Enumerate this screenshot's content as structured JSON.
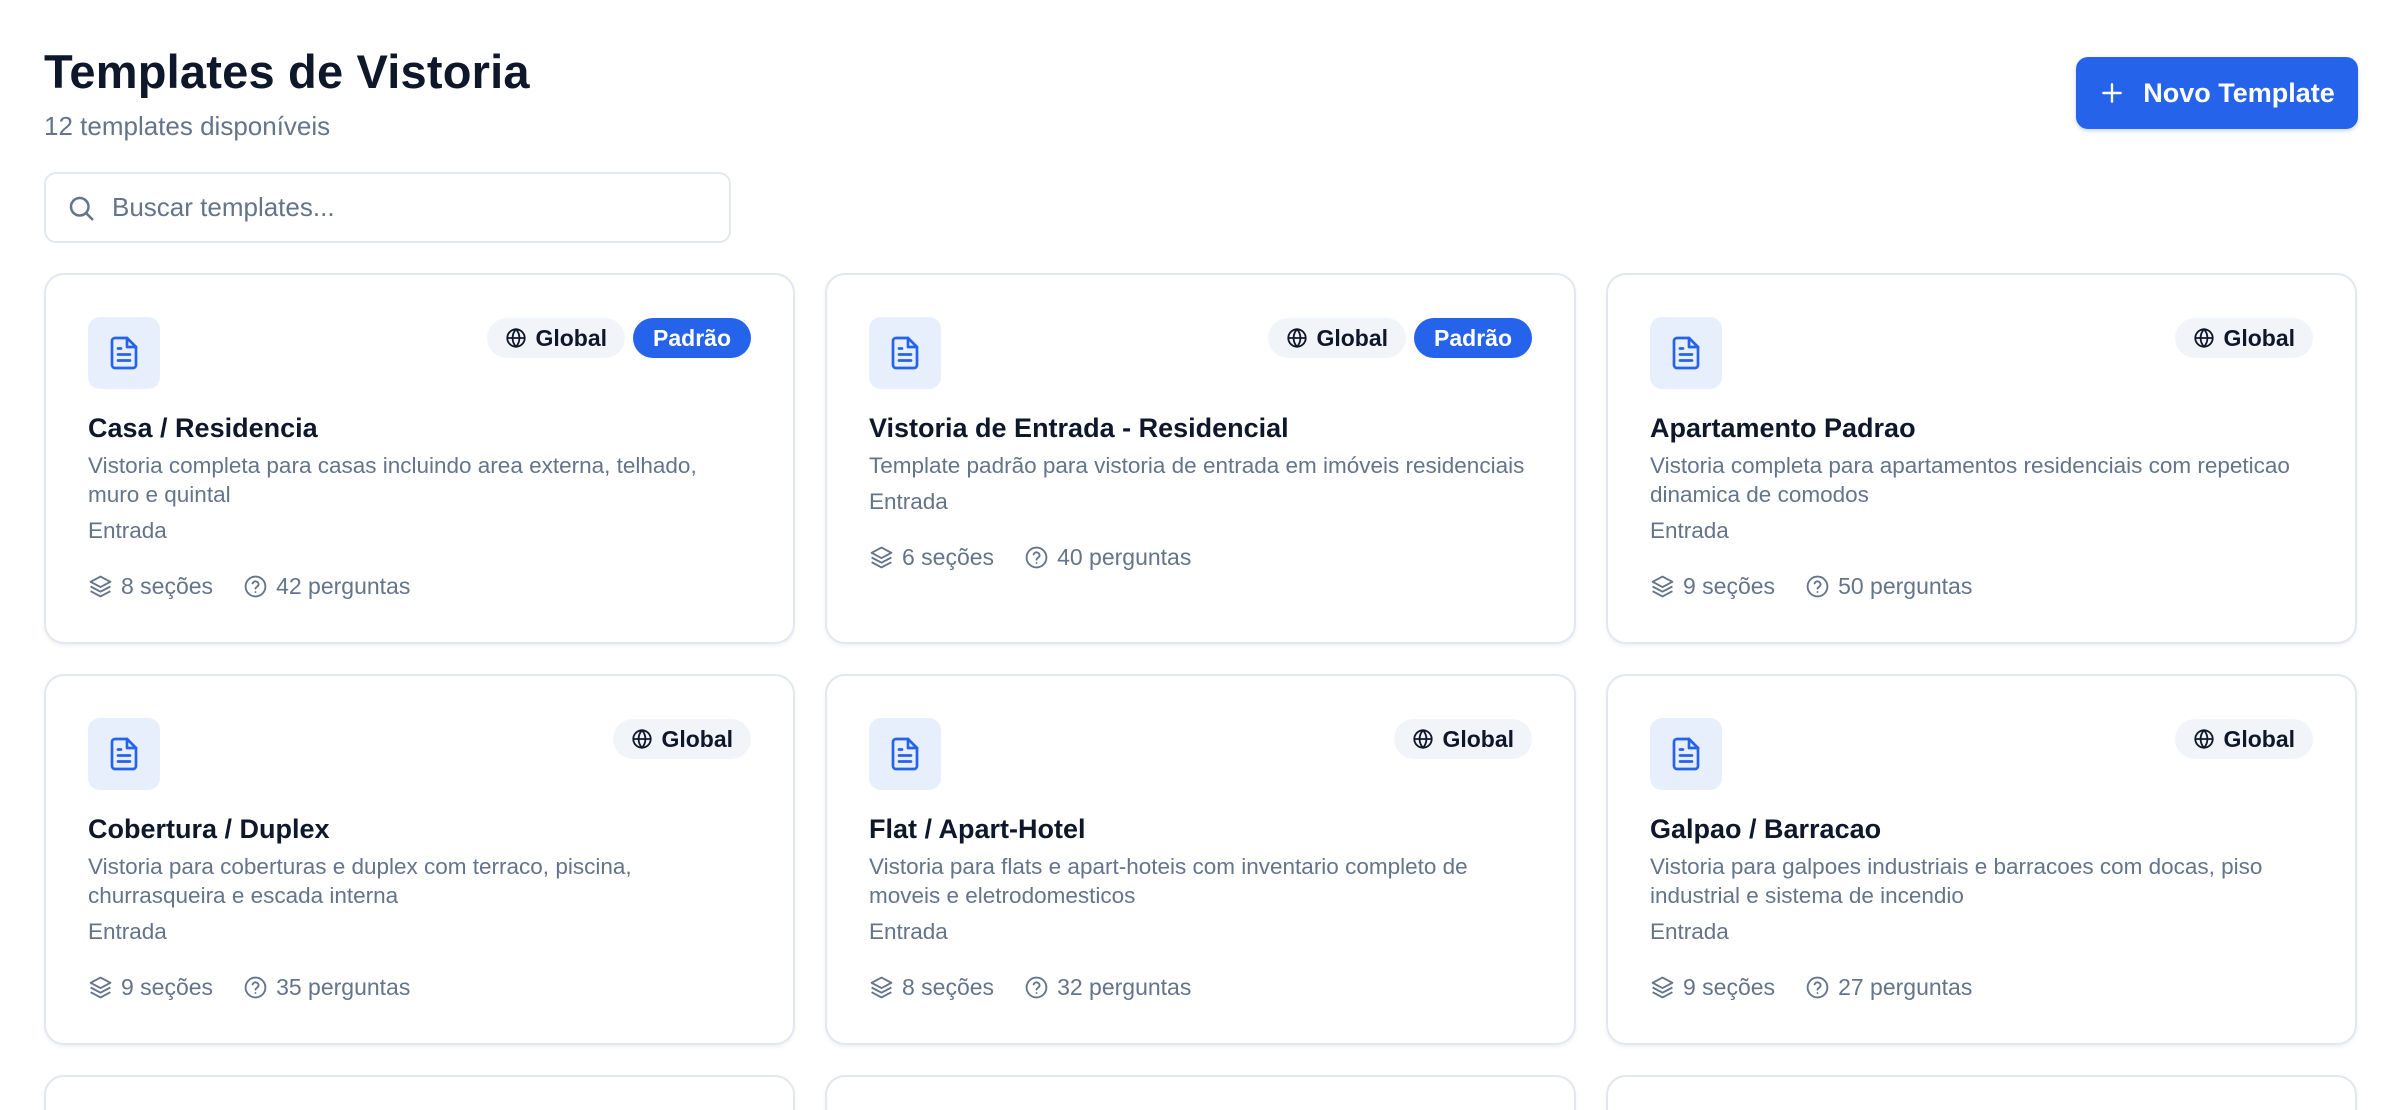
{
  "header": {
    "title": "Templates de Vistoria",
    "subtitle": "12 templates disponíveis"
  },
  "actions": {
    "new_template_label": "Novo Template"
  },
  "search": {
    "placeholder": "Buscar templates..."
  },
  "icons": {
    "card": "file-text-icon",
    "scope": "globe-icon",
    "sections": "layers-icon",
    "questions": "help-circle-icon",
    "search": "search-icon",
    "add": "plus-icon"
  },
  "colors": {
    "accent": "#2563eb",
    "muted_text": "#64748b",
    "icon_bg": "#e8effc"
  },
  "templates": [
    {
      "title": "Casa / Residencia",
      "description": "Vistoria completa para casas incluindo area externa, telhado, muro e quintal",
      "type": "Entrada",
      "scope": "Global",
      "default_badge": "Padrão",
      "sections": "8 seções",
      "questions": "42 perguntas"
    },
    {
      "title": "Vistoria de Entrada - Residencial",
      "description": "Template padrão para vistoria de entrada em imóveis residenciais",
      "type": "Entrada",
      "scope": "Global",
      "default_badge": "Padrão",
      "sections": "6 seções",
      "questions": "40 perguntas"
    },
    {
      "title": "Apartamento Padrao",
      "description": "Vistoria completa para apartamentos residenciais com repeticao dinamica de comodos",
      "type": "Entrada",
      "scope": "Global",
      "sections": "9 seções",
      "questions": "50 perguntas"
    },
    {
      "title": "Cobertura / Duplex",
      "description": "Vistoria para coberturas e duplex com terraco, piscina, churrasqueira e escada interna",
      "type": "Entrada",
      "scope": "Global",
      "sections": "9 seções",
      "questions": "35 perguntas"
    },
    {
      "title": "Flat / Apart-Hotel",
      "description": "Vistoria para flats e apart-hoteis com inventario completo de moveis e eletrodomesticos",
      "type": "Entrada",
      "scope": "Global",
      "sections": "8 seções",
      "questions": "32 perguntas"
    },
    {
      "title": "Galpao / Barracao",
      "description": "Vistoria para galpoes industriais e barracoes com docas, piso industrial e sistema de incendio",
      "type": "Entrada",
      "scope": "Global",
      "sections": "9 seções",
      "questions": "27 perguntas"
    }
  ]
}
